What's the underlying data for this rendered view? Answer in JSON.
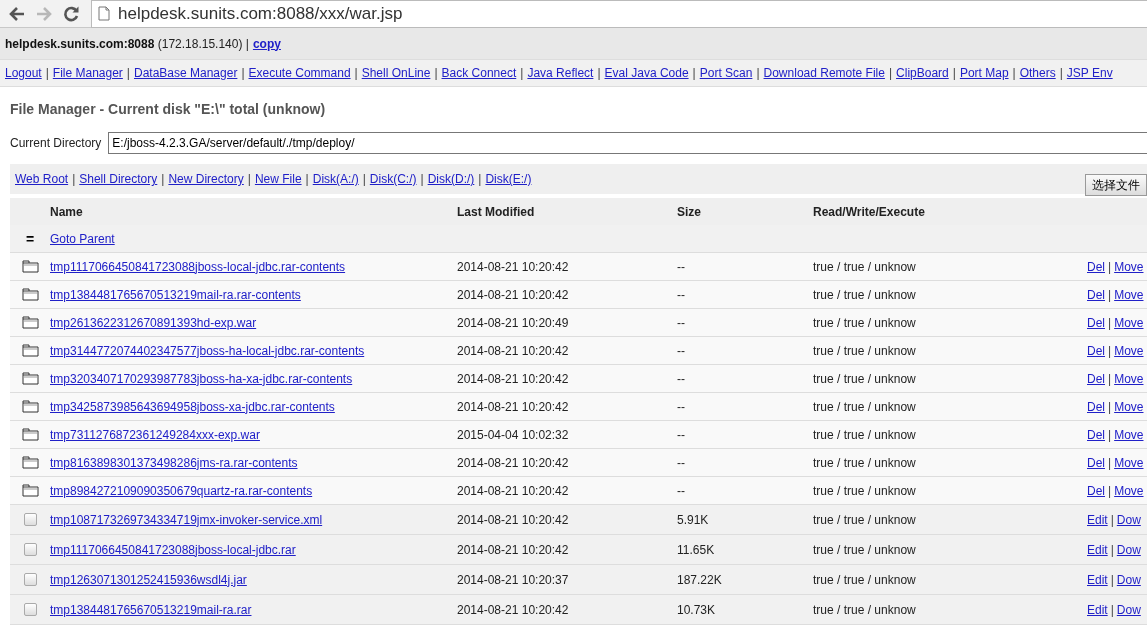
{
  "browser": {
    "url": "helpdesk.sunits.com:8088/xxx/war.jsp",
    "back_disabled": false,
    "forward_disabled": true
  },
  "info": {
    "text": "**helpdesk.sunits.com:8088** (172.18.15.140) |",
    "link": "copy"
  },
  "separator": "|",
  "nav": [
    "Logout",
    "File Manager",
    "DataBase Manager",
    "Execute Command",
    "Shell OnLine",
    "Back Connect",
    "Java Reflect",
    "Eval Java Code",
    "Port Scan",
    "Download Remote File",
    "ClipBoard",
    "Port Map",
    "Others",
    "JSP Env"
  ],
  "heading": "File Manager - Current disk \"E:\\\" total (unknow)",
  "directory": {
    "label": "Current Directory",
    "value": "E:/jboss-4.2.3.GA/server/default/./tmp/deploy/"
  },
  "actions": [
    "Web Root",
    "Shell Directory",
    "New Directory",
    "New File",
    "Disk(A:/)",
    "Disk(C:/)",
    "Disk(D:/)",
    "Disk(E:/)"
  ],
  "file_button": "选择文件",
  "table": {
    "columns": [
      "Name",
      "Last Modified",
      "Size",
      "Read/Write/Execute"
    ],
    "parent": {
      "icon": "=",
      "label": "Goto Parent"
    },
    "rows": [
      {
        "kind": "dir",
        "name": "tmp1117066450841723088jboss-local-jdbc.rar-contents",
        "modified": "2014-08-21 10:20:42",
        "size": "--",
        "rwx": "true / true / unknow",
        "links": [
          "Del",
          "Move"
        ]
      },
      {
        "kind": "dir",
        "name": "tmp1384481765670513219mail-ra.rar-contents",
        "modified": "2014-08-21 10:20:42",
        "size": "--",
        "rwx": "true / true / unknow",
        "links": [
          "Del",
          "Move"
        ]
      },
      {
        "kind": "dir",
        "name": "tmp2613622312670891393hd-exp.war",
        "modified": "2014-08-21 10:20:49",
        "size": "--",
        "rwx": "true / true / unknow",
        "links": [
          "Del",
          "Move"
        ]
      },
      {
        "kind": "dir",
        "name": "tmp3144772074402347577jboss-ha-local-jdbc.rar-contents",
        "modified": "2014-08-21 10:20:42",
        "size": "--",
        "rwx": "true / true / unknow",
        "links": [
          "Del",
          "Move"
        ]
      },
      {
        "kind": "dir",
        "name": "tmp3203407170293987783jboss-ha-xa-jdbc.rar-contents",
        "modified": "2014-08-21 10:20:42",
        "size": "--",
        "rwx": "true / true / unknow",
        "links": [
          "Del",
          "Move"
        ]
      },
      {
        "kind": "dir",
        "name": "tmp3425873985643694958jboss-xa-jdbc.rar-contents",
        "modified": "2014-08-21 10:20:42",
        "size": "--",
        "rwx": "true / true / unknow",
        "links": [
          "Del",
          "Move"
        ]
      },
      {
        "kind": "dir",
        "name": "tmp7311276872361249284xxx-exp.war",
        "modified": "2015-04-04 10:02:32",
        "size": "--",
        "rwx": "true / true / unknow",
        "links": [
          "Del",
          "Move"
        ]
      },
      {
        "kind": "dir",
        "name": "tmp8163898301373498286jms-ra.rar-contents",
        "modified": "2014-08-21 10:20:42",
        "size": "--",
        "rwx": "true / true / unknow",
        "links": [
          "Del",
          "Move"
        ]
      },
      {
        "kind": "dir",
        "name": "tmp8984272109090350679quartz-ra.rar-contents",
        "modified": "2014-08-21 10:20:42",
        "size": "--",
        "rwx": "true / true / unknow",
        "links": [
          "Del",
          "Move"
        ]
      },
      {
        "kind": "file",
        "checked": false,
        "name": "tmp1087173269734334719jmx-invoker-service.xml",
        "modified": "2014-08-21 10:20:42",
        "size": "5.91K",
        "rwx": "true / true / unknow",
        "links": [
          "Edit",
          "Dow"
        ]
      },
      {
        "kind": "file",
        "checked": false,
        "name": "tmp1117066450841723088jboss-local-jdbc.rar",
        "modified": "2014-08-21 10:20:42",
        "size": "11.65K",
        "rwx": "true / true / unknow",
        "links": [
          "Edit",
          "Dow"
        ]
      },
      {
        "kind": "file",
        "checked": false,
        "name": "tmp1263071301252415936wsdl4j.jar",
        "modified": "2014-08-21 10:20:37",
        "size": "187.22K",
        "rwx": "true / true / unknow",
        "links": [
          "Edit",
          "Dow"
        ]
      },
      {
        "kind": "file",
        "checked": false,
        "name": "tmp1384481765670513219mail-ra.rar",
        "modified": "2014-08-21 10:20:42",
        "size": "10.73K",
        "rwx": "true / true / unknow",
        "links": [
          "Edit",
          "Dow"
        ]
      }
    ]
  }
}
